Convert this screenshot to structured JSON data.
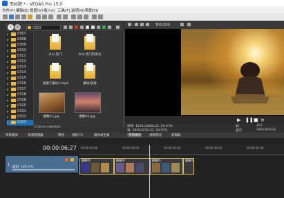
{
  "window": {
    "title": "无标题 * - VEGAS Pro 15.0"
  },
  "menu": [
    "文件(F)",
    "编辑(E)",
    "视图(V)",
    "插入(I)",
    "工具(T)",
    "选项(O)",
    "帮助(H)"
  ],
  "explorer": {
    "address": "0323",
    "tree": [
      "0307",
      "0308",
      "0309",
      "0310",
      "0311",
      "0312",
      "0313",
      "0314",
      "0315",
      "0316",
      "0317",
      "0318",
      "0319",
      "0320",
      "0321",
      "0322",
      "0323"
    ],
    "selected": "0323",
    "files": [
      {
        "name": "大山-热门",
        "kind": "folder"
      },
      {
        "name": "大山-热门的黑长",
        "kind": "folder"
      },
      {
        "name": "底图下备份3.mp4",
        "kind": "video"
      },
      {
        "name": "素材/链接",
        "kind": "video"
      },
      {
        "name": "图像01.jpg",
        "kind": "image"
      },
      {
        "name": "图像02.jpg",
        "kind": "image"
      }
    ],
    "status": "2 items selected"
  },
  "preview": {
    "quality": "预览(自动)",
    "info_line1": "项目: 1920x1080x32, 29.970i",
    "info_line2": "帧: 1920x270x32, 29.970i",
    "frame_label": "帧:",
    "frame_value": "207",
    "display_label": "显示:",
    "display_value": "540x304x32"
  },
  "tabs": [
    "项目媒体",
    "资源管理器",
    "转场",
    "视频 FX",
    "媒体发生器",
    "项目媒体",
    "视频预览",
    "剪辑器"
  ],
  "timeline": {
    "timecode": "00:00:06;27",
    "ruler_labels": [
      "00:00:00;00",
      "00:00:10;00",
      "00:00:20;00",
      "00:00:30;00",
      "00:00:40;00"
    ],
    "track_number": "1",
    "track_level": "级别: 100.0 %",
    "clips": [
      "图像01",
      "图像02",
      "图像01",
      "图像02"
    ]
  },
  "colors": {
    "accent": "#1d6fb7",
    "track": "#4a6e90",
    "clip_border": "#d8c060"
  }
}
